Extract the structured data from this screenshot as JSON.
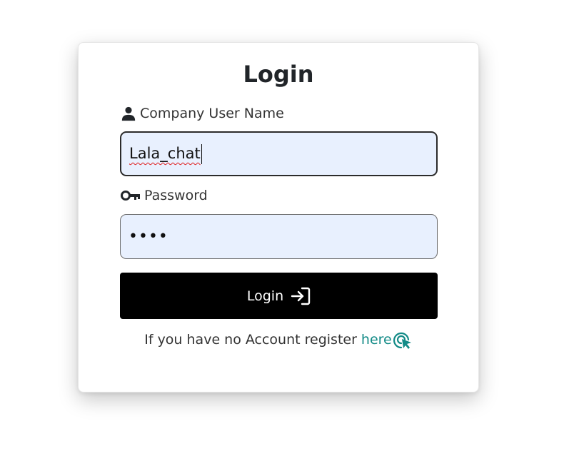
{
  "login_card": {
    "title": "Login",
    "username": {
      "label": "Company User Name",
      "value": "Lala_chat",
      "icon": "person-icon"
    },
    "password": {
      "label": "Password",
      "masked_value": "••••",
      "icon": "key-icon"
    },
    "submit": {
      "label": "Login",
      "icon": "sign-in-arrow-icon"
    },
    "register": {
      "text": "If you have no Account register",
      "link_label": "here",
      "icon": "cursor-click-icon"
    }
  },
  "colors": {
    "button_bg": "#000000",
    "input_bg": "#e8f0fe",
    "link": "#138b87"
  }
}
